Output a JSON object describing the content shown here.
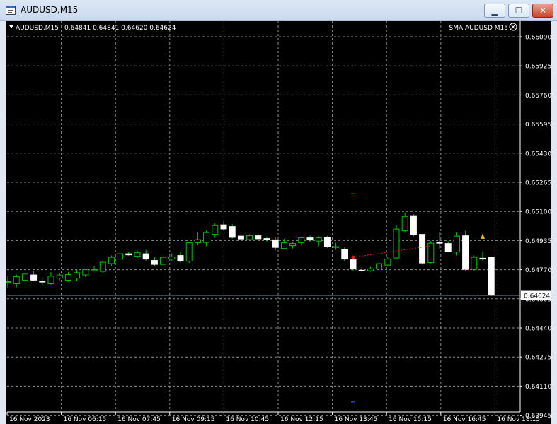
{
  "window": {
    "title": "AUDUSD,M15",
    "min_glyph": "▁",
    "max_glyph": "☐",
    "close_glyph": "✕"
  },
  "header": {
    "symbol": "AUDUSD,M15",
    "ohlc": "0.64841 0.64841 0.64620 0.64624",
    "indicator": "SMA AUDUSD M15"
  },
  "colors": {
    "background": "#000000",
    "grid": "#8c8c8c",
    "bull_body": "#000000",
    "bull_wick": "#00c800",
    "bear_body": "#ffffff",
    "bear_wick": "#00c800",
    "text": "#ffffff",
    "bid_line": "#6f8fa0",
    "trade_line": "#d22020",
    "frame": "#dfe8f3"
  },
  "price_axis": {
    "labels": [
      "0.66090",
      "0.65925",
      "0.65760",
      "0.65595",
      "0.65430",
      "0.65265",
      "0.65100",
      "0.64935",
      "0.64770",
      "0.64605",
      "0.64440",
      "0.64275",
      "0.64110",
      "0.63945"
    ],
    "current_price": "0.64624"
  },
  "time_axis": {
    "labels": [
      "16 Nov 2023",
      "16 Nov 06:15",
      "16 Nov 07:45",
      "16 Nov 09:15",
      "16 Nov 10:45",
      "16 Nov 12:15",
      "16 Nov 13:45",
      "16 Nov 15:15",
      "16 Nov 16:45",
      "16 Nov 18:15"
    ]
  },
  "chart_data": {
    "type": "candlestick",
    "symbol": "AUDUSD",
    "timeframe": "M15",
    "grid": true,
    "ylim": [
      0.6388,
      0.6615
    ],
    "candles": [
      {
        "o": 0.647,
        "h": 0.64732,
        "l": 0.64668,
        "c": 0.64703
      },
      {
        "o": 0.6469,
        "h": 0.64742,
        "l": 0.6467,
        "c": 0.6473
      },
      {
        "o": 0.6471,
        "h": 0.64752,
        "l": 0.64694,
        "c": 0.64745
      },
      {
        "o": 0.6474,
        "h": 0.64762,
        "l": 0.64704,
        "c": 0.64711
      },
      {
        "o": 0.64705,
        "h": 0.64722,
        "l": 0.64678,
        "c": 0.647
      },
      {
        "o": 0.6469,
        "h": 0.64756,
        "l": 0.64684,
        "c": 0.64733
      },
      {
        "o": 0.64722,
        "h": 0.64752,
        "l": 0.6471,
        "c": 0.6474
      },
      {
        "o": 0.6471,
        "h": 0.64756,
        "l": 0.64702,
        "c": 0.64742
      },
      {
        "o": 0.64722,
        "h": 0.64769,
        "l": 0.64704,
        "c": 0.64753
      },
      {
        "o": 0.6474,
        "h": 0.64776,
        "l": 0.64728,
        "c": 0.6477
      },
      {
        "o": 0.64764,
        "h": 0.64792,
        "l": 0.64758,
        "c": 0.6477
      },
      {
        "o": 0.6476,
        "h": 0.64822,
        "l": 0.6475,
        "c": 0.64812
      },
      {
        "o": 0.64804,
        "h": 0.6485,
        "l": 0.6479,
        "c": 0.6484
      },
      {
        "o": 0.6483,
        "h": 0.64874,
        "l": 0.64828,
        "c": 0.6486
      },
      {
        "o": 0.6486,
        "h": 0.64872,
        "l": 0.64848,
        "c": 0.64854
      },
      {
        "o": 0.64846,
        "h": 0.64879,
        "l": 0.64836,
        "c": 0.64866
      },
      {
        "o": 0.6486,
        "h": 0.64882,
        "l": 0.6482,
        "c": 0.6483
      },
      {
        "o": 0.64822,
        "h": 0.6484,
        "l": 0.64792,
        "c": 0.648
      },
      {
        "o": 0.648,
        "h": 0.6485,
        "l": 0.64794,
        "c": 0.6484
      },
      {
        "o": 0.6483,
        "h": 0.64862,
        "l": 0.6482,
        "c": 0.64842
      },
      {
        "o": 0.6485,
        "h": 0.64872,
        "l": 0.64812,
        "c": 0.64818
      },
      {
        "o": 0.64818,
        "h": 0.64928,
        "l": 0.64808,
        "c": 0.64922
      },
      {
        "o": 0.64922,
        "h": 0.64982,
        "l": 0.6491,
        "c": 0.6494
      },
      {
        "o": 0.64924,
        "h": 0.64992,
        "l": 0.64902,
        "c": 0.6498
      },
      {
        "o": 0.6497,
        "h": 0.65032,
        "l": 0.6495,
        "c": 0.6502
      },
      {
        "o": 0.65024,
        "h": 0.65044,
        "l": 0.64992,
        "c": 0.65001
      },
      {
        "o": 0.65014,
        "h": 0.65027,
        "l": 0.64946,
        "c": 0.64953
      },
      {
        "o": 0.6496,
        "h": 0.64984,
        "l": 0.6494,
        "c": 0.64944
      },
      {
        "o": 0.6494,
        "h": 0.6497,
        "l": 0.64934,
        "c": 0.64962
      },
      {
        "o": 0.64962,
        "h": 0.64972,
        "l": 0.6494,
        "c": 0.64945
      },
      {
        "o": 0.64946,
        "h": 0.64954,
        "l": 0.6493,
        "c": 0.64939
      },
      {
        "o": 0.64939,
        "h": 0.64952,
        "l": 0.6488,
        "c": 0.64896
      },
      {
        "o": 0.6489,
        "h": 0.64944,
        "l": 0.64886,
        "c": 0.64922
      },
      {
        "o": 0.64906,
        "h": 0.64926,
        "l": 0.6489,
        "c": 0.64918
      },
      {
        "o": 0.64922,
        "h": 0.64956,
        "l": 0.6491,
        "c": 0.6495
      },
      {
        "o": 0.6495,
        "h": 0.64962,
        "l": 0.64928,
        "c": 0.64938
      },
      {
        "o": 0.64932,
        "h": 0.64958,
        "l": 0.64902,
        "c": 0.6495
      },
      {
        "o": 0.64954,
        "h": 0.64962,
        "l": 0.64892,
        "c": 0.649
      },
      {
        "o": 0.649,
        "h": 0.64922,
        "l": 0.64882,
        "c": 0.649
      },
      {
        "o": 0.64885,
        "h": 0.64897,
        "l": 0.6482,
        "c": 0.6483
      },
      {
        "o": 0.64826,
        "h": 0.64842,
        "l": 0.6476,
        "c": 0.64774
      },
      {
        "o": 0.64767,
        "h": 0.64784,
        "l": 0.64758,
        "c": 0.64764
      },
      {
        "o": 0.64764,
        "h": 0.64786,
        "l": 0.64758,
        "c": 0.64775
      },
      {
        "o": 0.64774,
        "h": 0.64814,
        "l": 0.64766,
        "c": 0.64804
      },
      {
        "o": 0.64796,
        "h": 0.6484,
        "l": 0.6479,
        "c": 0.6483
      },
      {
        "o": 0.64836,
        "h": 0.65022,
        "l": 0.64836,
        "c": 0.65
      },
      {
        "o": 0.6499,
        "h": 0.65092,
        "l": 0.6498,
        "c": 0.65072
      },
      {
        "o": 0.65076,
        "h": 0.65084,
        "l": 0.6496,
        "c": 0.6497
      },
      {
        "o": 0.6497,
        "h": 0.64972,
        "l": 0.648,
        "c": 0.64808
      },
      {
        "o": 0.6481,
        "h": 0.64932,
        "l": 0.64806,
        "c": 0.6492
      },
      {
        "o": 0.64924,
        "h": 0.64982,
        "l": 0.6489,
        "c": 0.6492
      },
      {
        "o": 0.64918,
        "h": 0.64932,
        "l": 0.6487,
        "c": 0.64871
      },
      {
        "o": 0.6487,
        "h": 0.6498,
        "l": 0.6485,
        "c": 0.6496
      },
      {
        "o": 0.64962,
        "h": 0.6499,
        "l": 0.6476,
        "c": 0.64772
      },
      {
        "o": 0.64772,
        "h": 0.6485,
        "l": 0.64765,
        "c": 0.6484
      },
      {
        "o": 0.64835,
        "h": 0.64872,
        "l": 0.6482,
        "c": 0.6483
      },
      {
        "o": 0.64841,
        "h": 0.64841,
        "l": 0.6462,
        "c": 0.64624
      }
    ],
    "trade": {
      "entry_index": 40,
      "entry_price": 0.6484,
      "exit_index": 49,
      "exit_price": 0.64905
    },
    "markers": [
      {
        "index": 40,
        "price": 0.652,
        "color": "#d22020"
      },
      {
        "index": 40,
        "price": 0.6402,
        "color": "#2040d0"
      }
    ]
  }
}
